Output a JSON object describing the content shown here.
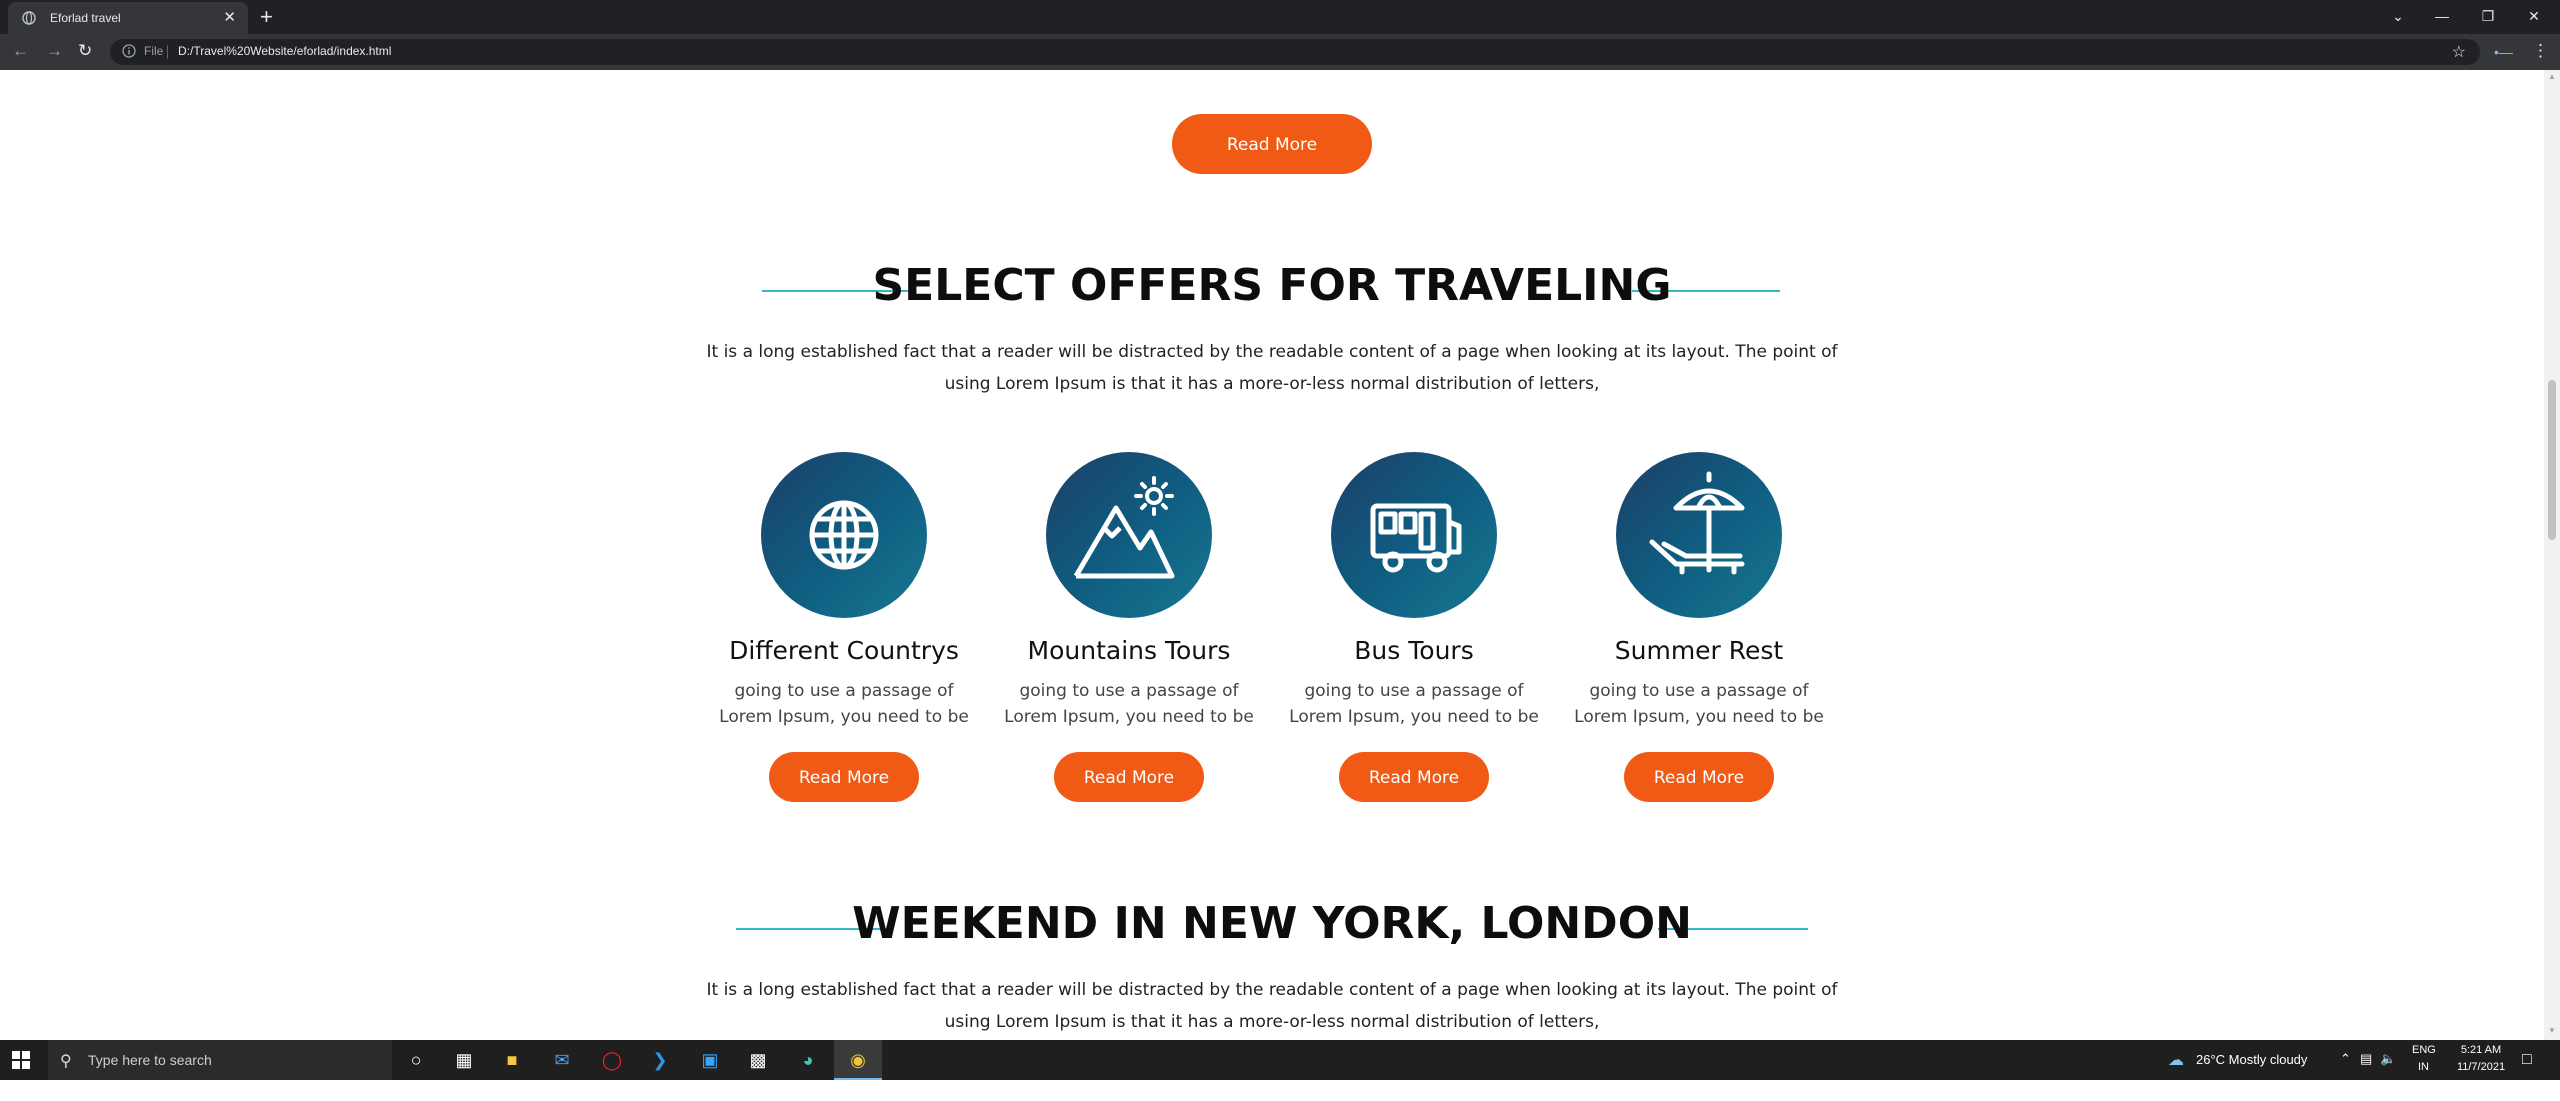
{
  "browser": {
    "tab_title": "Eforlad travel",
    "tab_close": "✕",
    "new_tab": "+",
    "url_prefix": "File",
    "url": "D:/Travel%20Website/eforlad/index.html",
    "window_controls": {
      "tab_search": "⌄",
      "minimize": "—",
      "restore": "❐",
      "close": "✕"
    }
  },
  "page": {
    "top_button": "Read More",
    "section1": {
      "heading": "SELECT OFFERS FOR TRAVELING",
      "text": "It is a long established fact that a reader will be distracted by the readable content of a page when looking at its layout. The point of using Lorem Ipsum is that it has a more-or-less normal distribution of letters,"
    },
    "cards": [
      {
        "icon": "globe-icon",
        "title": "Different Countrys",
        "text": "going to use a passage of Lorem Ipsum, you need to be",
        "button": "Read More"
      },
      {
        "icon": "mountain-sun-icon",
        "title": "Mountains Tours",
        "text": "going to use a passage of Lorem Ipsum, you need to be",
        "button": "Read More"
      },
      {
        "icon": "bus-icon",
        "title": "Bus Tours",
        "text": "going to use a passage of Lorem Ipsum, you need to be",
        "button": "Read More"
      },
      {
        "icon": "beach-umbrella-icon",
        "title": "Summer Rest",
        "text": "going to use a passage of Lorem Ipsum, you need to be",
        "button": "Read More"
      }
    ],
    "section2": {
      "heading": "WEEKEND IN NEW YORK, LONDON",
      "text": "It is a long established fact that a reader will be distracted by the readable content of a page when looking at its layout. The point of using Lorem Ipsum is that it has a more-or-less normal distribution of letters,"
    }
  },
  "taskbar": {
    "search_placeholder": "Type here to search",
    "weather": "26°C  Mostly cloudy",
    "lang": "ENG",
    "region": "IN",
    "time": "5:21 AM",
    "date": "11/7/2021"
  },
  "colors": {
    "accent": "#f05a14",
    "teal_line": "#36b7c4",
    "circle_dark": "#1e3f68",
    "circle_light": "#177891"
  }
}
